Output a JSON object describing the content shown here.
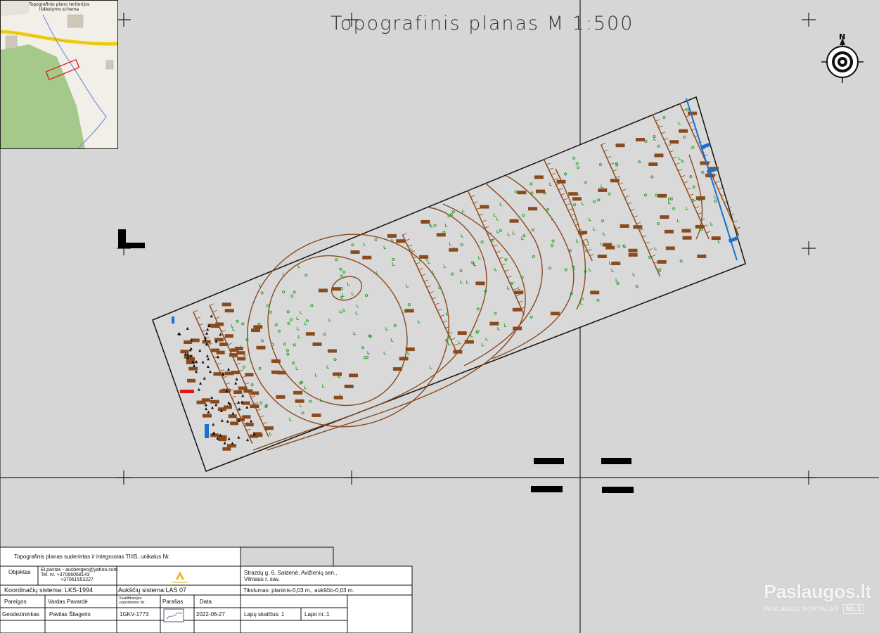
{
  "title": "Topografinis planas M 1:500",
  "north_label": "N",
  "inset": {
    "title_lines": [
      "Topografinio plano teritorijos",
      "išdėstymo schema"
    ]
  },
  "title_block": {
    "header": "Topografinis planas suderintas ir integruotas TIIIS, unikalus Nr.",
    "objektas_label": "Objektas",
    "contact_lines": [
      "El.pastas - ausbergeo@yahoo.com",
      "Tel. nr. +37066068143",
      "+37061553227"
    ],
    "address_lines": [
      "Strazdų g. 6, Saldenė, Avižienių sen.,",
      "Vilniaus r. sav."
    ],
    "coord_system": "Koordinačių sistema: LKS-1994",
    "height_system": "Aukščių sistema:LAS 07",
    "accuracy": "Tikslumas: planinis-0,03 m., aukščio-0,03 m.",
    "col_headers": [
      "Pareigos",
      "Vardas Pavardė",
      "Kvalifikacijos patvirtinimo Nr.",
      "Parašas",
      "Data"
    ],
    "row": [
      "Geodezininkas",
      "Pavilas Šliageris",
      "1GKV-1773",
      "",
      "2022-06-27"
    ],
    "sheets_count": "Lapų skaičius: 1",
    "sheet_no": "Lapo nr.:1"
  },
  "watermark": {
    "brand": "Paslaugos.lt",
    "sub": "PASLAUGŲ PORTALAS",
    "badge": "Nr.1"
  },
  "colors": {
    "background": "#d6d6d6",
    "contour": "#8b4a1c",
    "tree_marker": "#8b4a1c",
    "vegetation": "#2aa02a",
    "water": "#1a6fd4",
    "road": "#f4d21a",
    "forest": "#a5c98a",
    "plot_outline": "#e01818"
  }
}
